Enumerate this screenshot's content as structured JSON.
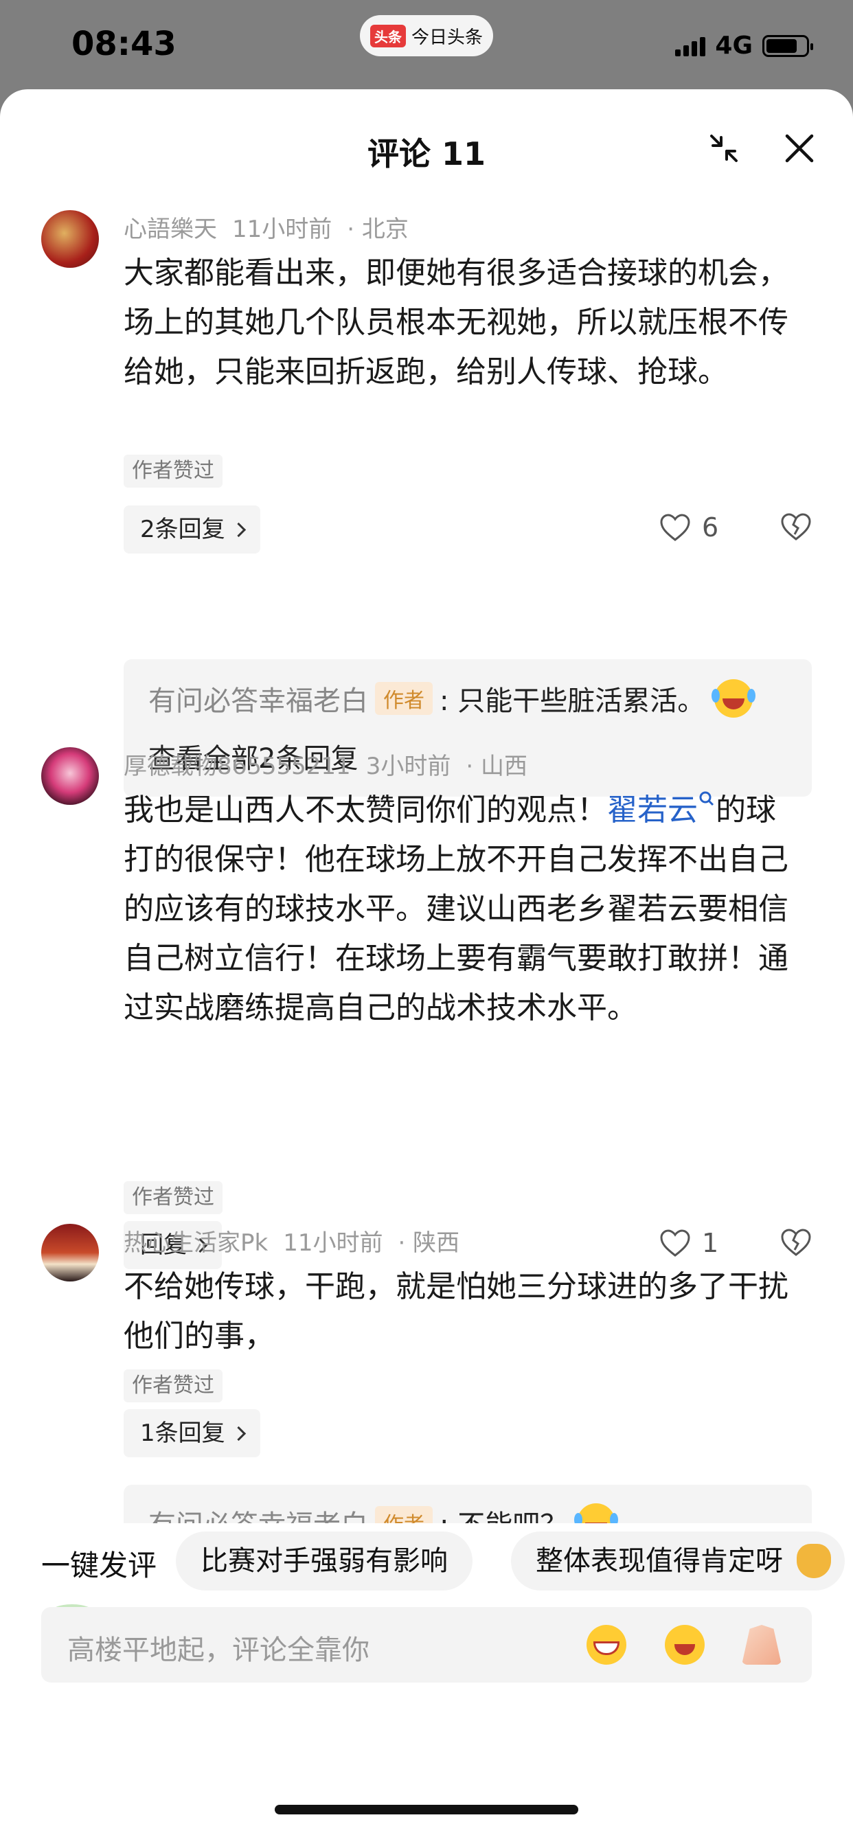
{
  "status_bar": {
    "time": "08:43",
    "app_badge": "头条",
    "app_name": "今日头条",
    "network": "4G"
  },
  "sheet": {
    "title": "评论 11"
  },
  "comments": [
    {
      "user": "心語樂天",
      "time": "11小时前",
      "location": "北京",
      "text": "大家都能看出来，即便她有很多适合接球的机会，场上的其她几个队员根本无视她，所以就压根不传给她，只能来回折返跑，给别人传球、抢球。",
      "liked_tag": "作者赞过",
      "reply_label": "2条回复",
      "likes": "6",
      "reply_preview": {
        "user": "有问必答幸福老白",
        "badge": "作者",
        "text": ": 只能干些脏活累活。",
        "view_all": "查看全部2条回复"
      }
    },
    {
      "user": "厚德载物865555211",
      "time": "3小时前",
      "location": "山西",
      "text_before_link": "我也是山西人不太赞同你们的观点！",
      "link": "翟若云",
      "text_after_link": "的球打的很保守！他在球场上放不开自己发挥不出自己的应该有的球技水平。建议山西老乡翟若云要相信自己树立信行！在球场上要有霸气要敢打敢拼！通过实战磨练提高自己的战术技术水平。",
      "liked_tag": "作者赞过",
      "reply_label": "回复",
      "likes": "1"
    },
    {
      "user": "热心生活家Pk",
      "time": "11小时前",
      "location": "陕西",
      "text": "不给她传球，干跑，就是怕她三分球进的多了干扰他们的事，",
      "liked_tag": "作者赞过",
      "reply_label": "1条回复",
      "reply_preview": {
        "user": "有问必答幸福老白",
        "badge": "作者",
        "text": ": 不能吧？"
      }
    }
  ],
  "quick_reply": {
    "label": "一键发评",
    "chips": [
      "比赛对手强弱有影响",
      "整体表现值得肯定呀"
    ]
  },
  "input": {
    "placeholder": "高楼平地起，评论全靠你"
  },
  "colors": {
    "link": "#2662c9",
    "author_badge_bg": "#fbe9d5",
    "author_badge_text": "#d08a2c"
  }
}
